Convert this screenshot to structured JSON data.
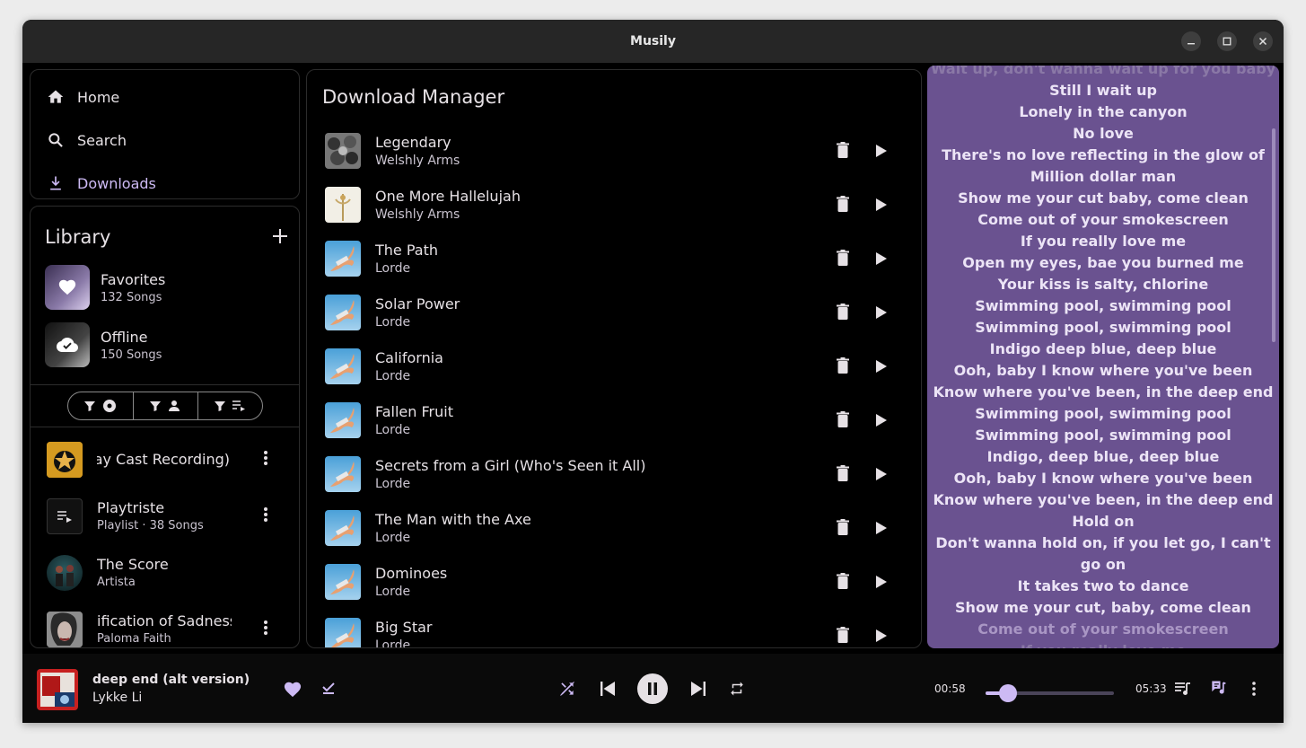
{
  "window": {
    "title": "Musily"
  },
  "nav": {
    "items": [
      {
        "label": "Home",
        "icon": "home-icon"
      },
      {
        "label": "Search",
        "icon": "search-icon"
      },
      {
        "label": "Downloads",
        "icon": "download-icon",
        "active": true
      }
    ]
  },
  "library": {
    "title": "Library",
    "pinned": [
      {
        "name": "Favorites",
        "sub": "132 Songs",
        "icon": "heart-icon"
      },
      {
        "name": "Offline",
        "sub": "150 Songs",
        "icon": "cloud-check-icon"
      }
    ],
    "filters": [
      "album-filter",
      "artist-filter",
      "playlist-filter"
    ],
    "items": [
      {
        "name": "way Cast Recording)",
        "sub": ""
      },
      {
        "name": "Playtriste",
        "sub": "Playlist · 38 Songs"
      },
      {
        "name": "The Score",
        "sub": "Artista"
      },
      {
        "name": "ification of Sadness",
        "sub": "Paloma Faith"
      }
    ]
  },
  "downloads": {
    "title": "Download Manager",
    "tracks": [
      {
        "name": "Legendary",
        "artist": "Welshly Arms"
      },
      {
        "name": "One More Hallelujah",
        "artist": "Welshly Arms"
      },
      {
        "name": "The Path",
        "artist": "Lorde"
      },
      {
        "name": "Solar Power",
        "artist": "Lorde"
      },
      {
        "name": "California",
        "artist": "Lorde"
      },
      {
        "name": "Fallen Fruit",
        "artist": "Lorde"
      },
      {
        "name": "Secrets from a Girl (Who's Seen it All)",
        "artist": "Lorde"
      },
      {
        "name": "The Man with the Axe",
        "artist": "Lorde"
      },
      {
        "name": "Dominoes",
        "artist": "Lorde"
      },
      {
        "name": "Big Star",
        "artist": "Lorde"
      }
    ]
  },
  "lyrics": {
    "lines": [
      "Wait up, don't wanna wait up for you baby",
      "Still I wait up",
      "Lonely in the canyon",
      "No love",
      "There's no love reflecting in the glow of",
      "Million dollar man",
      "Show me your cut baby, come clean",
      "Come out of your smokescreen",
      "If you really love me",
      "Open my eyes, bae you burned me",
      "Your kiss is salty, chlorine",
      "Swimming pool, swimming pool",
      "Swimming pool, swimming pool",
      "Indigo deep blue, deep blue",
      "Ooh, baby I know where you've been",
      "Know where you've been, in the deep end",
      "Swimming pool, swimming pool",
      "Swimming pool, swimming pool",
      "Indigo, deep blue, deep blue",
      "Ooh, baby I know where you've been",
      "Know where you've been, in the deep end",
      "Hold on",
      "Don't wanna hold on, if you let go, I can't",
      "go on",
      "It takes two to dance",
      "Show me your cut, baby, come clean",
      "Come out of your smokescreen",
      "If you really love me"
    ]
  },
  "player": {
    "title": "deep end (alt version)",
    "artist": "Lykke Li",
    "elapsed": "00:58",
    "duration": "05:33",
    "progress": 0.175
  },
  "colors": {
    "accent": "#cdbaf4",
    "lyrics_bg": "#6a5290"
  }
}
